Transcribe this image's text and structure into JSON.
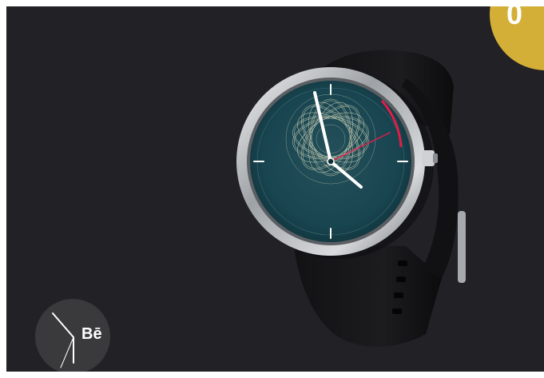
{
  "corner_badge": {
    "text": "0",
    "color": "#d4af37"
  },
  "behance_badge": {
    "text": "Bē",
    "icon": "behance-logo"
  },
  "watch": {
    "strap_color": "#18181a",
    "case_color": "#b9bcc0",
    "dial_color": "#1d5c66",
    "spirograph_color": "#e7e4c3",
    "second_hand_color": "#e11d48"
  }
}
